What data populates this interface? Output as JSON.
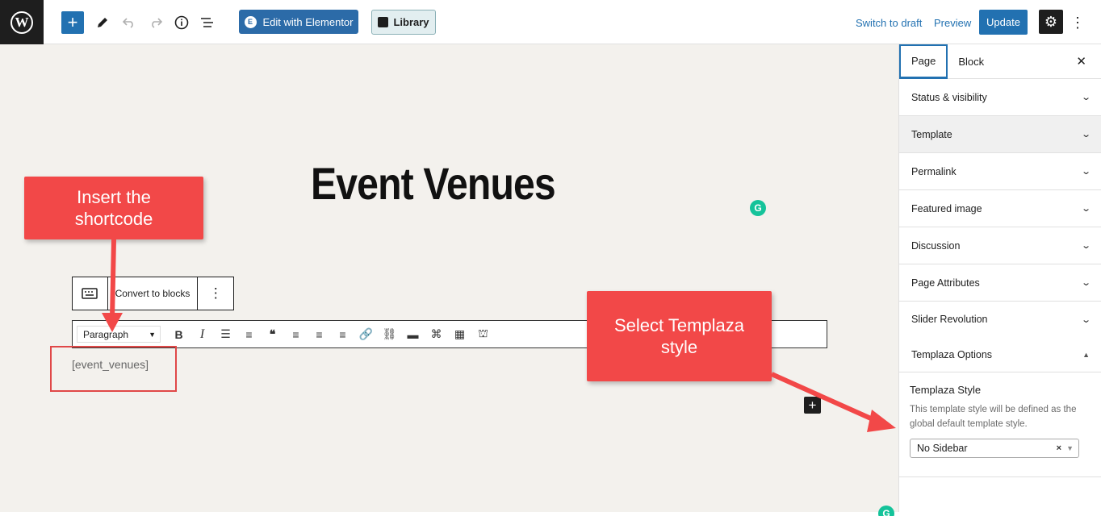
{
  "topbar": {
    "logo_letter": "W",
    "add_icon": "+",
    "elementor_label": "Edit with Elementor",
    "library_label": "Library",
    "switch_to_draft": "Switch to draft",
    "preview": "Preview",
    "update": "Update"
  },
  "editor": {
    "page_title": "Event Venues",
    "convert_to_blocks": "Convert to blocks",
    "format_select": "Paragraph",
    "shortcode": "[event_venues]"
  },
  "callouts": {
    "insert": "Insert the shortcode",
    "select": "Select Templaza style"
  },
  "sidebar": {
    "tabs": [
      "Page",
      "Block"
    ],
    "panels": [
      "Status & visibility",
      "Template",
      "Permalink",
      "Featured image",
      "Discussion",
      "Page Attributes",
      "Slider Revolution",
      "Templaza Options"
    ],
    "templaza": {
      "style_label": "Templaza Style",
      "help": "This template style will be defined as the global default template style.",
      "selected": "No Sidebar"
    }
  },
  "colors": {
    "accent": "#2271b1",
    "callout": "#f24848",
    "canvas_bg": "#f3f1ed",
    "grammarly": "#15c39a"
  },
  "icons": {
    "wordpress": "wordpress-logo-icon",
    "edit": "pencil-icon",
    "undo": "undo-icon",
    "redo": "redo-icon",
    "info": "info-icon",
    "outline": "list-view-icon",
    "settings": "gear-icon"
  }
}
